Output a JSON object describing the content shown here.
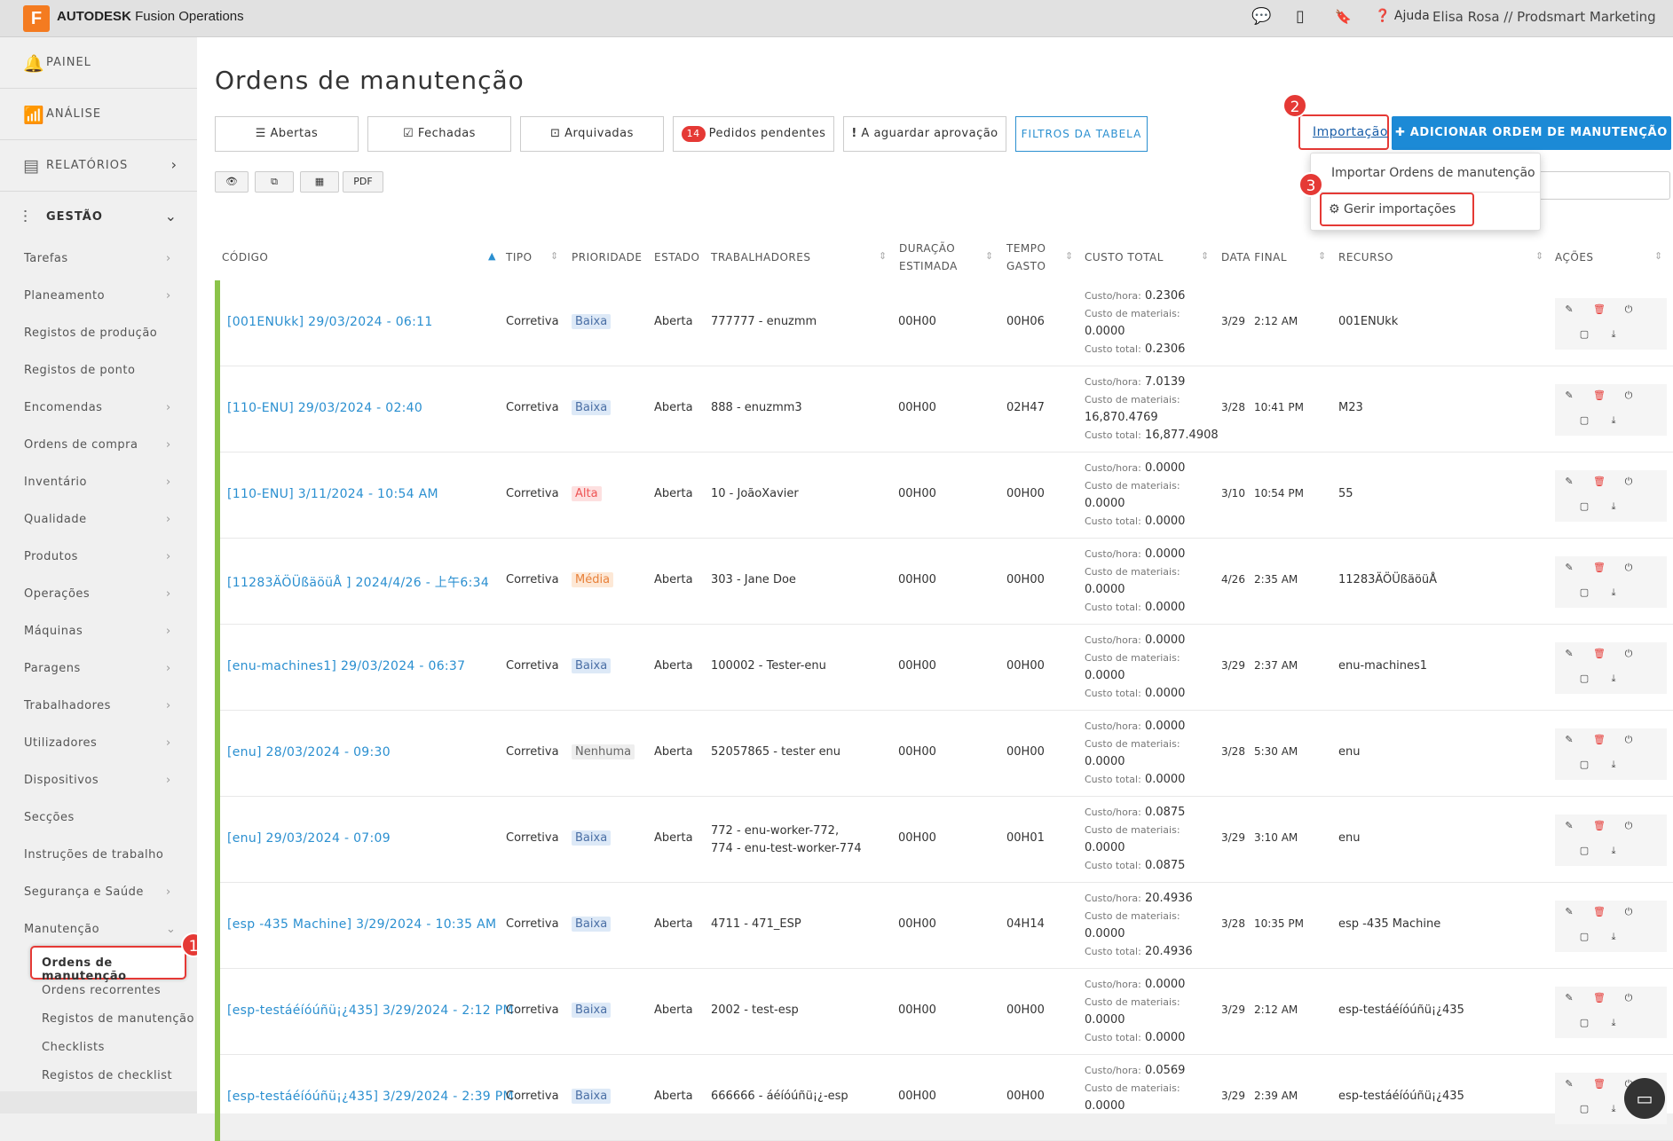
{
  "app": {
    "brand": "AUTODESK",
    "product": "Fusion Operations",
    "logo_letter": "F"
  },
  "topbar": {
    "help": "Ajuda",
    "user": "Elisa Rosa // Prodsmart Marketing"
  },
  "sidebar": {
    "main": [
      {
        "label": "PAINEL"
      },
      {
        "label": "ANÁLISE"
      },
      {
        "label": "RELATÓRIOS"
      },
      {
        "label": "GESTÃO"
      }
    ],
    "sub": [
      {
        "label": "Tarefas",
        "chevron": true
      },
      {
        "label": "Planeamento",
        "chevron": true
      },
      {
        "label": "Registos de produção",
        "chevron": false
      },
      {
        "label": "Registos de ponto",
        "chevron": false
      },
      {
        "label": "Encomendas",
        "chevron": true
      },
      {
        "label": "Ordens de compra",
        "chevron": true
      },
      {
        "label": "Inventário",
        "chevron": true
      },
      {
        "label": "Qualidade",
        "chevron": true
      },
      {
        "label": "Produtos",
        "chevron": true
      },
      {
        "label": "Operações",
        "chevron": true
      },
      {
        "label": "Máquinas",
        "chevron": true
      },
      {
        "label": "Paragens",
        "chevron": true
      },
      {
        "label": "Trabalhadores",
        "chevron": true
      },
      {
        "label": "Utilizadores",
        "chevron": true
      },
      {
        "label": "Dispositivos",
        "chevron": true
      },
      {
        "label": "Secções",
        "chevron": false
      },
      {
        "label": "Instruções de trabalho",
        "chevron": false
      },
      {
        "label": "Segurança e Saúde",
        "chevron": true
      },
      {
        "label": "Manutenção",
        "chevron": true
      }
    ],
    "maintenance": [
      {
        "label": "Ordens de manutenção"
      },
      {
        "label": "Ordens recorrentes"
      },
      {
        "label": "Registos de manutenção"
      },
      {
        "label": "Checklists"
      },
      {
        "label": "Registos de checklist"
      }
    ]
  },
  "page": {
    "title": "Ordens de manutenção"
  },
  "tabs": {
    "abertas": "Abertas",
    "fechadas": "Fechadas",
    "arquivadas": "Arquivadas",
    "pendentes_count": "14",
    "pendentes": "Pedidos pendentes",
    "aprovacao": "A aguardar aprovação",
    "filters": "FILTROS DA TABELA"
  },
  "export": {
    "pdf": "PDF"
  },
  "toolbar": {
    "import": "Importação",
    "add": "ADICIONAR ORDEM DE MANUTENÇÃO",
    "dropdown": {
      "import_orders": "Importar Ordens de manutenção",
      "manage_imports": "Gerir importações"
    }
  },
  "annotations": {
    "n1": "1",
    "n2": "2",
    "n3": "3"
  },
  "table": {
    "headers": {
      "codigo": "CÓDIGO",
      "tipo": "TIPO",
      "prioridade": "PRIORIDADE",
      "estado": "ESTADO",
      "trabalhadores": "TRABALHADORES",
      "duracao1": "DURAÇÃO",
      "duracao2": "ESTIMADA",
      "tempo1": "TEMPO",
      "tempo2": "GASTO",
      "custo": "CUSTO TOTAL",
      "data": "DATA FINAL",
      "recurso": "RECURSO",
      "acoes": "AÇÕES"
    },
    "cost_labels": {
      "hour": "Custo/hora:",
      "materials": "Custo de materiais:",
      "total": "Custo total:"
    },
    "rows": [
      {
        "code": "[001ENUkk] 29/03/2024 - 06:11",
        "type": "Corretiva",
        "priority": "Baixa",
        "pclass": "baixa",
        "state": "Aberta",
        "workers": [
          "777777 - enuzmm"
        ],
        "duration": "00H00",
        "spent": "00H06",
        "cost_hour": "0.2306",
        "cost_mat": "0.0000",
        "cost_total": "0.2306",
        "date": "3/29",
        "time": "2:12 AM",
        "resource": "001ENUkk"
      },
      {
        "code": "[110-ENU] 29/03/2024 - 02:40",
        "type": "Corretiva",
        "priority": "Baixa",
        "pclass": "baixa",
        "state": "Aberta",
        "workers": [
          "888 - enuzmm3"
        ],
        "duration": "00H00",
        "spent": "02H47",
        "cost_hour": "7.0139",
        "cost_mat": "16,870.4769",
        "cost_total": "16,877.4908",
        "date": "3/28",
        "time": "10:41 PM",
        "resource": "M23"
      },
      {
        "code": "[110-ENU] 3/11/2024 - 10:54 AM",
        "type": "Corretiva",
        "priority": "Alta",
        "pclass": "alta",
        "state": "Aberta",
        "workers": [
          "10 - JoãoXavier"
        ],
        "duration": "00H00",
        "spent": "00H00",
        "cost_hour": "0.0000",
        "cost_mat": "0.0000",
        "cost_total": "0.0000",
        "date": "3/10",
        "time": "10:54 PM",
        "resource": "55"
      },
      {
        "code": "[11283ÄÖÜßäöüÅ ] 2024/4/26 - 上午6:34",
        "type": "Corretiva",
        "priority": "Média",
        "pclass": "media",
        "state": "Aberta",
        "workers": [
          "303 - Jane Doe"
        ],
        "duration": "00H00",
        "spent": "00H00",
        "cost_hour": "0.0000",
        "cost_mat": "0.0000",
        "cost_total": "0.0000",
        "date": "4/26",
        "time": "2:35 AM",
        "resource": "11283ÄÖÜßäöüÅ"
      },
      {
        "code": "[enu-machines1] 29/03/2024 - 06:37",
        "type": "Corretiva",
        "priority": "Baixa",
        "pclass": "baixa",
        "state": "Aberta",
        "workers": [
          "100002 - Tester-enu"
        ],
        "duration": "00H00",
        "spent": "00H00",
        "cost_hour": "0.0000",
        "cost_mat": "0.0000",
        "cost_total": "0.0000",
        "date": "3/29",
        "time": "2:37 AM",
        "resource": "enu-machines1"
      },
      {
        "code": "[enu] 28/03/2024 - 09:30",
        "type": "Corretiva",
        "priority": "Nenhuma",
        "pclass": "nenhuma",
        "state": "Aberta",
        "workers": [
          "52057865 - tester enu"
        ],
        "duration": "00H00",
        "spent": "00H00",
        "cost_hour": "0.0000",
        "cost_mat": "0.0000",
        "cost_total": "0.0000",
        "date": "3/28",
        "time": "5:30 AM",
        "resource": "enu"
      },
      {
        "code": "[enu] 29/03/2024 - 07:09",
        "type": "Corretiva",
        "priority": "Baixa",
        "pclass": "baixa",
        "state": "Aberta",
        "workers": [
          "772 - enu-worker-772,",
          "774 - enu-test-worker-774"
        ],
        "duration": "00H00",
        "spent": "00H01",
        "cost_hour": "0.0875",
        "cost_mat": "0.0000",
        "cost_total": "0.0875",
        "date": "3/29",
        "time": "3:10 AM",
        "resource": "enu"
      },
      {
        "code": "[esp -435 Machine] 3/29/2024 - 10:35 AM",
        "type": "Corretiva",
        "priority": "Baixa",
        "pclass": "baixa",
        "state": "Aberta",
        "workers": [
          "4711 - 471_ESP"
        ],
        "duration": "00H00",
        "spent": "04H14",
        "cost_hour": "20.4936",
        "cost_mat": "0.0000",
        "cost_total": "20.4936",
        "date": "3/28",
        "time": "10:35 PM",
        "resource": "esp -435 Machine"
      },
      {
        "code": "[esp-testáéíóúñü¡¿435] 3/29/2024 - 2:12 PM",
        "type": "Corretiva",
        "priority": "Baixa",
        "pclass": "baixa",
        "state": "Aberta",
        "workers": [
          "2002 - test-esp"
        ],
        "duration": "00H00",
        "spent": "00H00",
        "cost_hour": "0.0000",
        "cost_mat": "0.0000",
        "cost_total": "0.0000",
        "date": "3/29",
        "time": "2:12 AM",
        "resource": "esp-testáéíóúñü¡¿435"
      },
      {
        "code": "[esp-testáéíóúñü¡¿435] 3/29/2024 - 2:39 PM",
        "type": "Corretiva",
        "priority": "Baixa",
        "pclass": "baixa",
        "state": "Aberta",
        "workers": [
          "666666 - áéíóúñü¡¿-esp"
        ],
        "duration": "00H00",
        "spent": "00H00",
        "cost_hour": "0.0569",
        "cost_mat": "0.0000",
        "cost_total": "",
        "date": "3/29",
        "time": "2:39 AM",
        "resource": "esp-testáéíóúñü¡¿435"
      }
    ]
  }
}
